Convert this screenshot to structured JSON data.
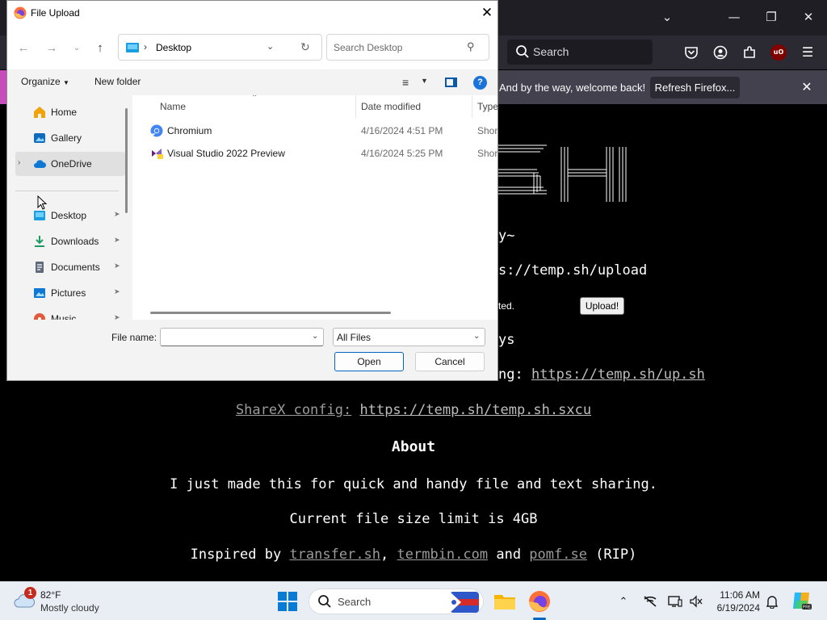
{
  "browser": {
    "toolbar": {
      "search_placeholder": "Search"
    },
    "notice": {
      "text": "And by the way, welcome back!",
      "refresh_label": "Refresh Firefox..."
    },
    "page": {
      "line_suffix_1": "y~",
      "upload_url_fragment": "s://temp.sh/upload",
      "upload_note": "ted.",
      "upload_button": "Upload!",
      "line_suffix_2": "ys",
      "curl_prefix": "ng: ",
      "curl_link": "https://temp.sh/up.sh",
      "sharex_label": "ShareX config:",
      "sharex_link": "https://temp.sh/temp.sh.sxcu",
      "about_heading": "About",
      "about_line1": "I just made this for quick and handy file and text sharing.",
      "about_line2": "Current file size limit is 4GB",
      "inspired_prefix": "Inspired by ",
      "inspired_links": [
        "transfer.sh",
        "termbin.com",
        "pomf.se"
      ],
      "inspired_sep1": ", ",
      "inspired_sep2": " and ",
      "inspired_suffix": " (RIP)"
    }
  },
  "dialog": {
    "title": "File Upload",
    "address": {
      "location": "Desktop"
    },
    "search_placeholder": "Search Desktop",
    "commands": {
      "organize": "Organize",
      "new_folder": "New folder"
    },
    "nav_items": [
      {
        "label": "Home",
        "icon": "home-icon"
      },
      {
        "label": "Gallery",
        "icon": "gallery-icon"
      },
      {
        "label": "OneDrive",
        "icon": "cloud-icon"
      },
      {
        "label": "Desktop",
        "icon": "desktop-icon"
      },
      {
        "label": "Downloads",
        "icon": "download-icon"
      },
      {
        "label": "Documents",
        "icon": "documents-icon"
      },
      {
        "label": "Pictures",
        "icon": "pictures-icon"
      },
      {
        "label": "Music",
        "icon": "music-icon"
      }
    ],
    "columns": {
      "name": "Name",
      "date": "Date modified",
      "type": "Type"
    },
    "files": [
      {
        "name": "Chromium",
        "date": "4/16/2024 4:51 PM",
        "type": "Short"
      },
      {
        "name": "Visual Studio 2022 Preview",
        "date": "4/16/2024 5:25 PM",
        "type": "Short"
      }
    ],
    "file_name_label": "File name:",
    "file_name_value": "",
    "filter_value": "All Files",
    "open_label": "Open",
    "cancel_label": "Cancel"
  },
  "taskbar": {
    "weather": {
      "badge": "1",
      "temp": "82°F",
      "desc": "Mostly cloudy"
    },
    "search_label": "Search",
    "clock": {
      "time": "11:06 AM",
      "date": "6/19/2024"
    }
  }
}
